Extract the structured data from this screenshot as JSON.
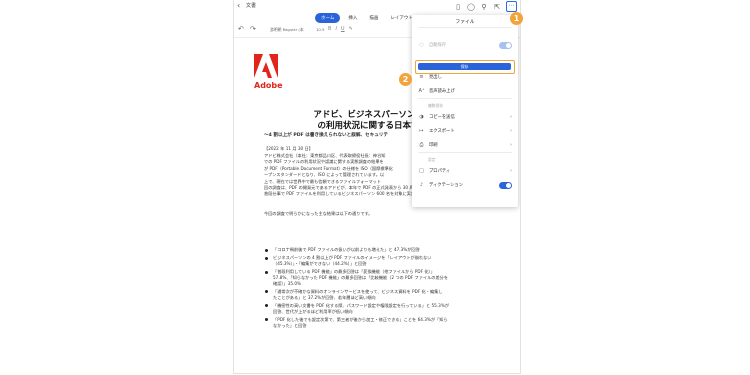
{
  "app": {
    "doc_title": "文書",
    "back_icon": "chevron-left-icon"
  },
  "top_icons": [
    "phone-icon",
    "lightbulb-icon",
    "search-icon",
    "share-icon",
    "more-icon"
  ],
  "tabs": [
    "ホーム",
    "挿入",
    "描画",
    "レイアウト",
    "校"
  ],
  "active_tab": "ホーム",
  "toolbar": {
    "font": "游明朝 Regular (本",
    "size": "10.5"
  },
  "document": {
    "logo_word": "Adobe",
    "title_line1": "アドビ、ビジネスパーソンによる",
    "title_line2": "の利用状況に関する日本での調",
    "subtitle": "〜4 割以上が PDF は書き換えられないと誤解、セキュリテ",
    "date": "【2022 年 11 月 30 日】",
    "body": [
      "アドビ株式会社（本社：東京都品川区、代表取締役社長：神谷知",
      "での PDF ファイルの利用状況や認識に関する実態調査の結果を",
      "が PDF（Portable Document Format）の仕様を ISO（国際標準化",
      "ープンスタンダードとなり、ISO によって管理されています。以",
      "上で、現在では世界中で最も信頼できるファイルフォーマット",
      "回の調査は、PDF の開発元であるアドビが、本年で PDF の正式発表から 30 周年を迎えたことか",
      "普段仕事で PDF ファイルを利用しているビジネスパーソン 600 名を対象に実施したものです。"
    ],
    "intro": "今回の調査で明らかになった主な結果は以下の通りです。",
    "bullets": [
      [
        "「コロナ禍前後で PDF ファイルの扱いが以前よりも増えた」と 47.3%が回答"
      ],
      [
        "ビジネスパーソンの 4 割以上が PDF ファイルのイメージを「レイアウトが崩れない",
        "（45.3%）」・「編集ができない（44.2%）」と回答"
      ],
      [
        "「普段利用している PDF 機能」の最多回答は「変換機能（他ファイルから PDF 化）」",
        "57.8%、「知らなかった PDF 機能」の最多回答は「比較機能（2 つの PDF ファイルの差分を",
        "確認）」35.0%"
      ],
      [
        "「通常次が不確かな資料のオンラインサービスを使って、ビジネス資料を PDF 化・編集し",
        "たことがある」と 37.2%が回答、若年層ほど高い傾向"
      ],
      [
        "「機密性の高い文書を PDF 化する際、パスワード設定や権限設定を行っている」と 55.3%が",
        "回答、世代が上がるほど利用率が低い傾向"
      ],
      [
        "「PDF 化した後でも設定次第で、第三者が後から加工・修正できる」ことを 64.3%が「知ら",
        "なかった」と回答"
      ]
    ]
  },
  "menu": {
    "title": "ファイル",
    "autosave_label": "自動保存",
    "save_label": "保存",
    "items": [
      {
        "label": "見出し",
        "icon": "headings-icon",
        "chevron": false,
        "dim": false
      },
      {
        "label": "音声読み上げ",
        "icon": "read-aloud-icon",
        "chevron": false,
        "dim": false
      },
      {
        "label": "複数保存",
        "icon": "",
        "chevron": false,
        "dim": true,
        "section": true
      },
      {
        "label": "コピーを送信",
        "icon": "send-copy-icon",
        "chevron": true,
        "dim": false
      },
      {
        "label": "エクスポート",
        "icon": "export-icon",
        "chevron": true,
        "dim": false
      },
      {
        "label": "印刷",
        "icon": "print-icon",
        "chevron": true,
        "dim": false
      },
      {
        "label": "設定",
        "icon": "",
        "chevron": false,
        "dim": true,
        "section": true
      },
      {
        "label": "プロパティ",
        "icon": "properties-icon",
        "chevron": true,
        "dim": false
      },
      {
        "label": "ディクテーション",
        "icon": "microphone-icon",
        "chevron": false,
        "dim": false,
        "toggle": true
      }
    ]
  },
  "callouts": {
    "first": "1",
    "second": "2"
  },
  "colors": {
    "accent": "#2b63d9",
    "callout": "#f2a33a",
    "adobe_red": "#e1251b"
  }
}
